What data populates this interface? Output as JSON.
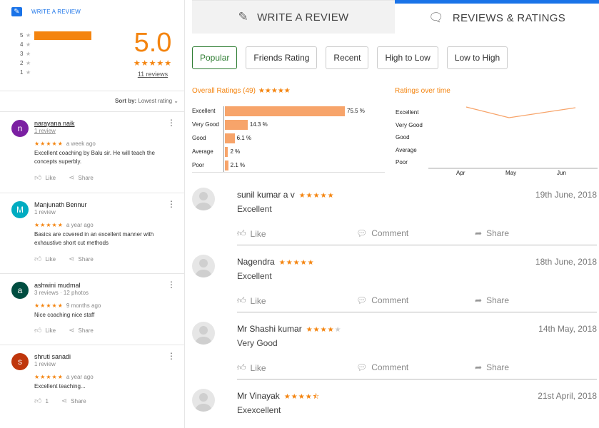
{
  "left": {
    "write_review": "WRITE A REVIEW",
    "distribution": [
      {
        "star": "5",
        "fraction": 1.0
      },
      {
        "star": "4",
        "fraction": 0
      },
      {
        "star": "3",
        "fraction": 0
      },
      {
        "star": "2",
        "fraction": 0
      },
      {
        "star": "1",
        "fraction": 0
      }
    ],
    "score": "5.0",
    "score_stars": "★★★★★",
    "reviews_count": "11 reviews",
    "sort_label": "Sort by:",
    "sort_value": "Lowest rating",
    "reviews": [
      {
        "initial": "n",
        "color": "#7b1fa2",
        "name": "narayana naik",
        "meta": "1 review",
        "stars": "★★★★★",
        "time": "a week ago",
        "text": "Excellent coaching by Balu sir. He will teach the concepts superbly.",
        "like": "Like",
        "share": "Share"
      },
      {
        "initial": "M",
        "color": "#00acc1",
        "name": "Manjunath Bennur",
        "meta": "1 review",
        "stars": "★★★★★",
        "time": "a year ago",
        "text": "Basics are covered in an excellent manner with exhaustive short cut methods",
        "like": "Like",
        "share": "Share"
      },
      {
        "initial": "a",
        "color": "#004d40",
        "name": "ashwini mudmal",
        "meta": "3 reviews · 12 photos",
        "stars": "★★★★★",
        "time": "9 months ago",
        "text": "Nice coaching nice staff",
        "like": "Like",
        "share": "Share"
      },
      {
        "initial": "s",
        "color": "#bf360c",
        "name": "shruti sanadi",
        "meta": "1 review",
        "stars": "★★★★★",
        "time": "a year ago",
        "text": "Excellent teaching...",
        "like": "1",
        "share": "Share"
      }
    ]
  },
  "tabs": {
    "write": "WRITE A REVIEW",
    "reviews": "REVIEWS & RATINGS"
  },
  "filters": [
    "Popular",
    "Friends Rating",
    "Recent",
    "High to Low",
    "Low to High"
  ],
  "overall": {
    "title": "Overall Ratings (49)",
    "stars": "★★★★★",
    "rows": [
      {
        "label": "Excellent",
        "value": 75.5,
        "pct": "75.5 %"
      },
      {
        "label": "Very Good",
        "value": 14.3,
        "pct": "14.3 %"
      },
      {
        "label": "Good",
        "value": 6.1,
        "pct": "6.1 %"
      },
      {
        "label": "Average",
        "value": 2,
        "pct": "2 %"
      },
      {
        "label": "Poor",
        "value": 2.1,
        "pct": "2.1 %"
      }
    ]
  },
  "chart_data": {
    "type": "line",
    "title": "Ratings over time",
    "x": [
      "Apr",
      "May",
      "Jun"
    ],
    "y_categories": [
      "Excellent",
      "Very Good",
      "Good",
      "Average",
      "Poor"
    ],
    "series": [
      {
        "values": [
          "Excellent",
          "Excellent",
          "Excellent"
        ]
      }
    ],
    "grid": false
  },
  "reviews": [
    {
      "name": "sunil kumar a v",
      "stars": 5,
      "date": "19th June, 2018",
      "text": "Excellent",
      "like": "Like",
      "comment": "Comment",
      "share": "Share"
    },
    {
      "name": "Nagendra",
      "stars": 5,
      "date": "18th June, 2018",
      "text": "Excellent",
      "like": "Like",
      "comment": "Comment",
      "share": "Share"
    },
    {
      "name": "Mr Shashi kumar",
      "stars": 4,
      "date": "14th May, 2018",
      "text": "Very Good",
      "like": "Like",
      "comment": "Comment",
      "share": "Share"
    },
    {
      "name": "Mr Vinayak",
      "stars": 4.5,
      "date": "21st April, 2018",
      "text": "Exexcellent",
      "like": "Like",
      "comment": "Comment",
      "share": "Share"
    }
  ],
  "colors": {
    "accent": "#f4840f",
    "link": "#1a73e8",
    "active_filter": "#2e7d32"
  }
}
